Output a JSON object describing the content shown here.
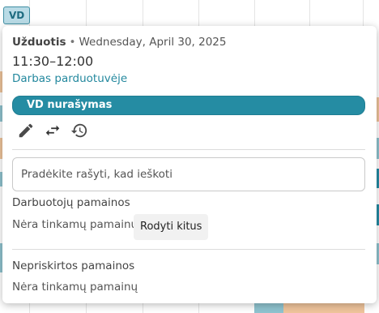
{
  "background": {
    "chip_label": "VD"
  },
  "popup": {
    "type_label": "Užduotis",
    "separator": "•",
    "date": "Wednesday, April 30, 2025",
    "time": "11:30–12:00",
    "location": "Darbas parduotuvėje",
    "tag": "VD nurašymas",
    "actions": {
      "edit_icon": "pencil-icon",
      "swap_icon": "swap-arrows-icon",
      "history_icon": "history-icon"
    },
    "search": {
      "placeholder": "Pradėkite rašyti, kad ieškoti"
    },
    "employee_shifts": {
      "title": "Darbuotojų pamainos",
      "empty": "Nėra tinkamų pamainų",
      "show_more": "Rodyti kitus"
    },
    "unassigned_shifts": {
      "title": "Nepriskirtos pamainos",
      "empty": "Nėra tinkamų pamainų"
    }
  },
  "colors": {
    "accent": "#258ca3",
    "orange_block": "#efc49b",
    "teal_block": "#8fc3cf"
  }
}
